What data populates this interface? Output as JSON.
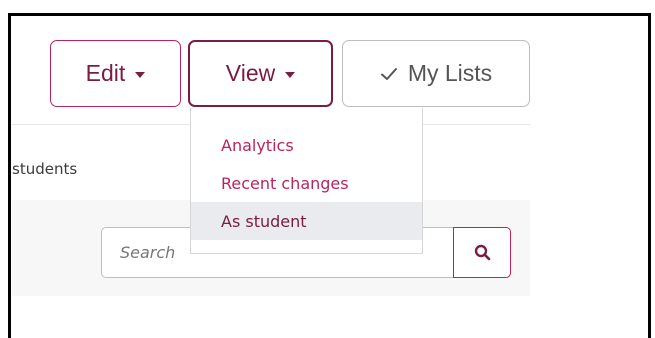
{
  "colors": {
    "accent": "#b9245f",
    "accent_dark": "#7a1c43",
    "neutral_border": "#bdbdbd",
    "menu_hover_bg": "#e9ebee"
  },
  "toolbar": {
    "edit_label": "Edit",
    "view_label": "View",
    "mylists_label": "My Lists"
  },
  "view_menu": {
    "items": [
      {
        "label": "Analytics"
      },
      {
        "label": "Recent changes"
      },
      {
        "label": "As student",
        "active": true
      }
    ]
  },
  "page": {
    "side_text": "students"
  },
  "search": {
    "placeholder": "Search",
    "icon": "search-icon"
  },
  "icons": {
    "edit_caret": "caret-down-icon",
    "view_caret": "caret-down-icon",
    "mylists_check": "check-icon"
  }
}
